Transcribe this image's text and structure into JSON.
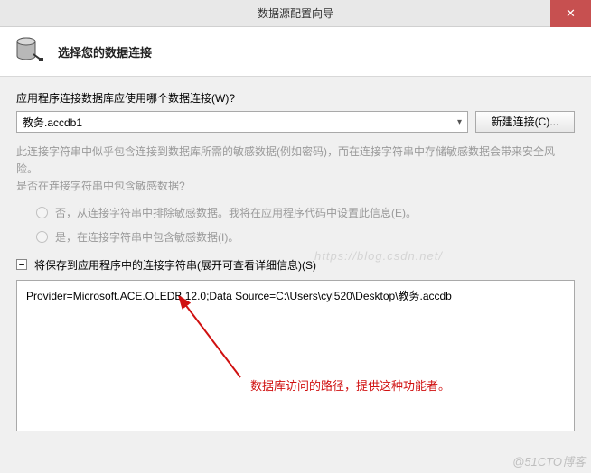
{
  "titlebar": {
    "title": "数据源配置向导",
    "close": "✕"
  },
  "header": {
    "title": "选择您的数据连接"
  },
  "prompt": "应用程序连接数据库应使用哪个数据连接(W)?",
  "connection": {
    "selected": "教务.accdb1",
    "new_button": "新建连接(C)..."
  },
  "warning_line1": "此连接字符串中似乎包含连接到数据库所需的敏感数据(例如密码)，而在连接字符串中存储敏感数据会带来安全风险。",
  "warning_line2": "是否在连接字符串中包含敏感数据?",
  "radio": {
    "opt1": "否，从连接字符串中排除敏感数据。我将在应用程序代码中设置此信息(E)。",
    "opt2": "是，在连接字符串中包含敏感数据(I)。"
  },
  "expander": {
    "symbol": "−",
    "label": "将保存到应用程序中的连接字符串(展开可查看详细信息)(S)"
  },
  "connection_string": "Provider=Microsoft.ACE.OLEDB.12.0;Data Source=C:\\Users\\cyl520\\Desktop\\教务.accdb",
  "annotation": "数据库访问的路径，提供这种功能者。",
  "watermark_blog": "https://blog.csdn.net/",
  "watermark_corner": "@51CTO博客"
}
